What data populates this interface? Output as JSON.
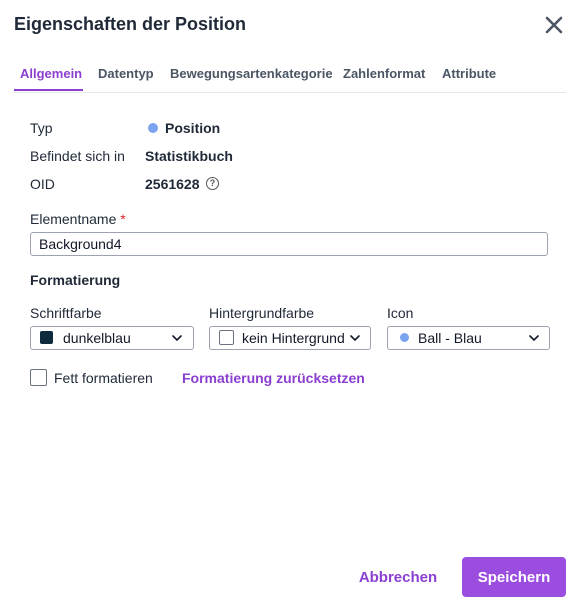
{
  "dialog": {
    "title": "Eigenschaften der Position",
    "close_icon": "close-icon"
  },
  "tabs": [
    {
      "label": "Allgemein",
      "active": true
    },
    {
      "label": "Datentyp",
      "active": false
    },
    {
      "label": "Bewegungsartenkategorie",
      "active": false
    },
    {
      "label": "Zahlenformat",
      "active": false
    },
    {
      "label": "Attribute",
      "active": false
    }
  ],
  "info": {
    "typ_label": "Typ",
    "typ_value": "Position",
    "typ_dot_color": "#7aa4f0",
    "location_label": "Befindet sich in",
    "location_value": "Statistikbuch",
    "oid_label": "OID",
    "oid_value": "2561628",
    "oid_help_icon": "question-circle-icon"
  },
  "element_name": {
    "label": "Elementname",
    "required_mark": "*",
    "value": "Background4"
  },
  "formatting": {
    "section_title": "Formatierung",
    "font_color": {
      "label": "Schriftfarbe",
      "value": "dunkelblau",
      "swatch": "#0f2a3d"
    },
    "background_color": {
      "label": "Hintergrundfarbe",
      "value": "kein Hintergrund",
      "swatch": "#ffffff"
    },
    "icon": {
      "label": "Icon",
      "value": "Ball - Blau",
      "dot_color": "#7aa4f0"
    },
    "bold_checkbox_label": "Fett formatieren",
    "bold_checked": false,
    "reset_link": "Formatierung zurücksetzen"
  },
  "footer": {
    "cancel_label": "Abbrechen",
    "save_label": "Speichern"
  },
  "colors": {
    "accent": "#8b3fd0",
    "primary_button": "#9b4de0"
  }
}
